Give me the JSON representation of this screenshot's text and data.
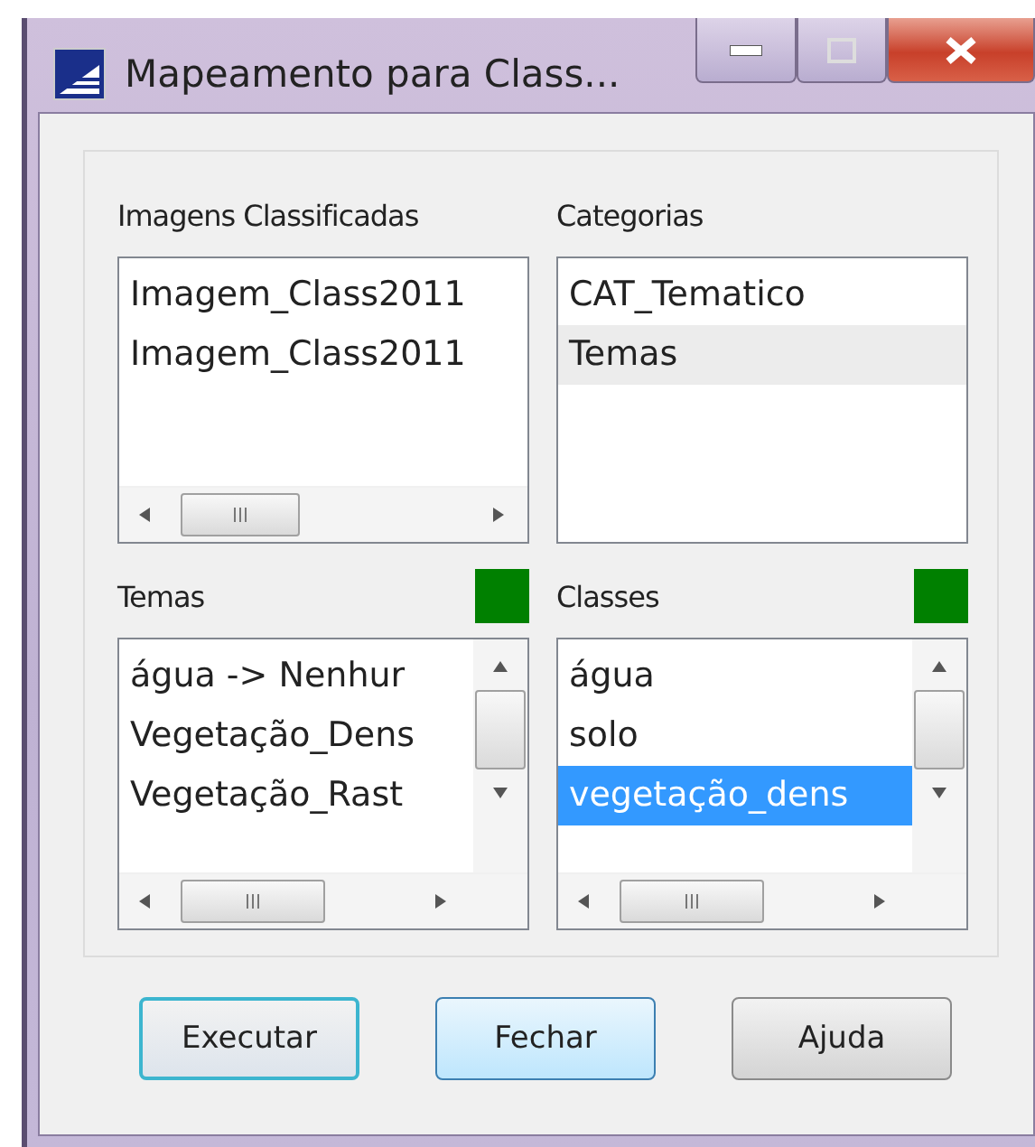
{
  "window": {
    "title": "Mapeamento para Class..."
  },
  "panels": [
    {
      "label": "Imagens Classificadas",
      "hscroll": true,
      "vscroll": false,
      "items": [
        {
          "text": "Imagem_Class2011",
          "selected": false
        },
        {
          "text": "Imagem_Class2011",
          "selected": false
        }
      ]
    },
    {
      "label": "Categorias",
      "hscroll": false,
      "vscroll": false,
      "items": [
        {
          "text": "CAT_Tematico",
          "selected": false
        },
        {
          "text": "Temas",
          "selected": true
        }
      ]
    },
    {
      "label": "Temas",
      "color": "#008000",
      "hscroll": true,
      "vscroll": true,
      "items": [
        {
          "text": "água -> Nenhur",
          "selected": false
        },
        {
          "text": "Vegetação_Dens",
          "selected": false
        },
        {
          "text": "Vegetação_Rast",
          "selected": false
        }
      ]
    },
    {
      "label": "Classes",
      "color": "#008000",
      "hscroll": true,
      "vscroll": true,
      "focused": true,
      "items": [
        {
          "text": "água",
          "selected": false
        },
        {
          "text": "solo",
          "selected": false
        },
        {
          "text": "vegetação_dens",
          "selected": true
        }
      ]
    }
  ],
  "buttons": [
    {
      "label": "Executar",
      "focused": true,
      "hovered": false
    },
    {
      "label": "Fechar",
      "focused": false,
      "hovered": true
    },
    {
      "label": "Ajuda",
      "focused": false,
      "hovered": false
    }
  ]
}
